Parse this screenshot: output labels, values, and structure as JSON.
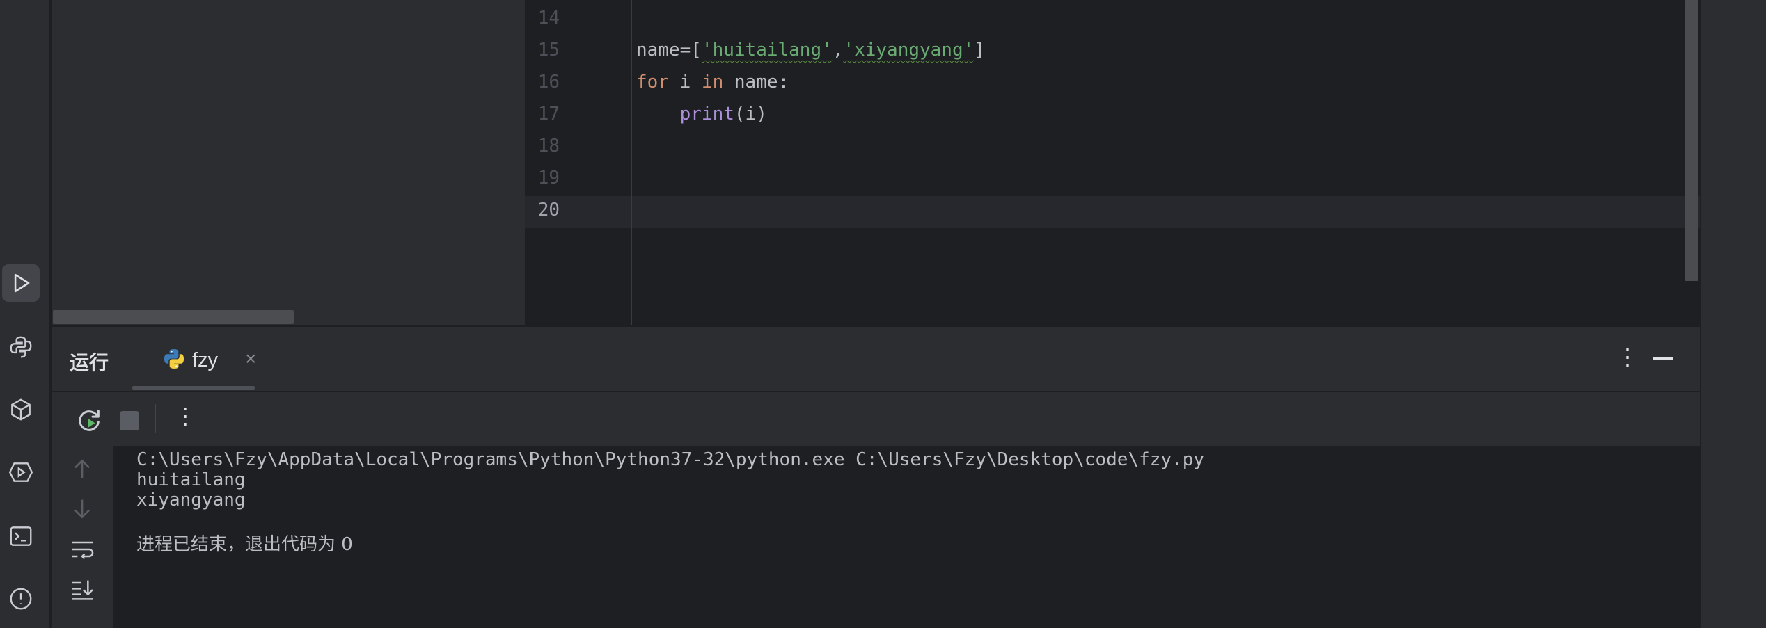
{
  "editor": {
    "lines": [
      {
        "num": "14",
        "code": []
      },
      {
        "num": "15",
        "code": [
          {
            "t": "name=[",
            "c": "plain"
          },
          {
            "t": "'huitailang'",
            "c": "str"
          },
          {
            "t": ",",
            "c": "plain"
          },
          {
            "t": "'xiyangyang'",
            "c": "str"
          },
          {
            "t": "]",
            "c": "plain"
          }
        ]
      },
      {
        "num": "16",
        "code": [
          {
            "t": "for",
            "c": "kw"
          },
          {
            "t": " i ",
            "c": "plain"
          },
          {
            "t": "in",
            "c": "kw"
          },
          {
            "t": " name:",
            "c": "plain"
          }
        ]
      },
      {
        "num": "17",
        "code": [
          {
            "t": "    ",
            "c": "plain"
          },
          {
            "t": "print",
            "c": "fn"
          },
          {
            "t": "(i)",
            "c": "plain"
          }
        ]
      },
      {
        "num": "18",
        "code": []
      },
      {
        "num": "19",
        "code": []
      },
      {
        "num": "20",
        "code": []
      }
    ],
    "current_line": "20"
  },
  "run": {
    "title": "运行",
    "tab_label": "fzy",
    "tab_close": "×",
    "options_icon": "⋮",
    "toolbar_more": "⋮",
    "output": [
      "C:\\Users\\Fzy\\AppData\\Local\\Programs\\Python\\Python37-32\\python.exe C:\\Users\\Fzy\\Desktop\\code\\fzy.py",
      "huitailang",
      "xiyangyang",
      "",
      "进程已结束，退出代码为 0"
    ]
  },
  "icons": {
    "left_strip": [
      "run-icon",
      "python-console-icon",
      "python-packages-icon",
      "services-icon",
      "terminal-icon",
      "problems-icon"
    ],
    "console_gutter": [
      "scroll-up-icon",
      "scroll-down-icon",
      "soft-wrap-icon",
      "scroll-to-end-icon"
    ]
  },
  "colors": {
    "keyword": "#cf8e6d",
    "function": "#a88fd8",
    "string": "#6aab73",
    "rerun": "#5fb865"
  }
}
